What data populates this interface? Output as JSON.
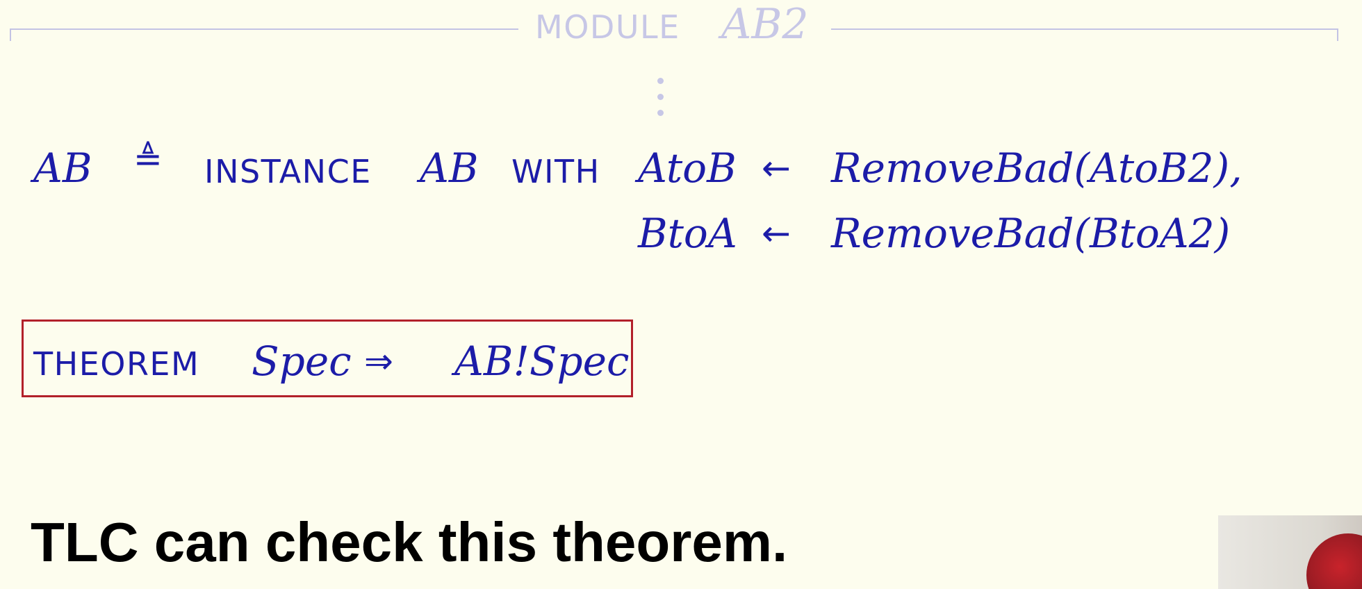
{
  "module_header": {
    "keyword": "MODULE",
    "name": "AB2"
  },
  "definition": {
    "lhs": "AB",
    "def_symbol": "≜",
    "instance_keyword": "INSTANCE",
    "instance_module": "AB",
    "with_keyword": "WITH",
    "substitutions": [
      {
        "param": "AtoB",
        "arrow": "←",
        "expr": "RemoveBad(AtoB2),"
      },
      {
        "param": "BtoA",
        "arrow": "←",
        "expr": "RemoveBad(BtoA2)"
      }
    ]
  },
  "theorem": {
    "keyword": "THEOREM",
    "lhs": "Spec",
    "implies": "⇒",
    "rhs": "AB!Spec"
  },
  "caption": "TLC can check this theorem.",
  "colors": {
    "background": "#fdfdee",
    "text": "#1c1ca8",
    "faded": "#c7c7e6",
    "box_border": "#b2202a",
    "caption": "#000000"
  }
}
